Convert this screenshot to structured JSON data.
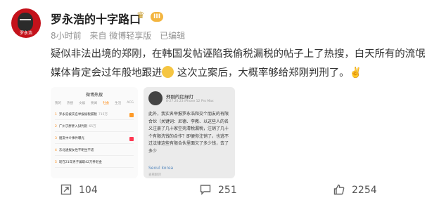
{
  "author": {
    "name": "罗永浩的十字路口",
    "badge_icon": "crown-icon",
    "level": "III",
    "avatar_caption": "罗永浩"
  },
  "meta": {
    "time": "8小时前",
    "source": "来自 微博轻享版",
    "edited": "已编辑"
  },
  "post": {
    "text_before_emoji": "疑似非法出境的郑刚，在韩国发帖诬陷我偷税漏税的帖子上了热搜，白天所有的流氓媒体肯定会过年般地跟进",
    "text_after_emoji": " 这次立案后，大概率够给郑刚判刑了。✌️"
  },
  "screenshot1": {
    "title": "微博热搜",
    "tabs": [
      "我的",
      "热搜",
      "文娱",
      "要闻",
      "社会",
      "生活",
      "ACG"
    ],
    "active_tab": 4,
    "rows": [
      {
        "num": "1",
        "text": "罗永浩被实名举报偷税漏税",
        "hot": "715万",
        "tag": "hot"
      },
      {
        "num": "2",
        "text": "广州于胖胖入狱判刑",
        "hot": "65万",
        "tag": ""
      },
      {
        "num": "3",
        "text": "朋友中介事件曝光",
        "hot": "",
        "tag": "new"
      },
      {
        "num": "4",
        "text": "东北通报女性不明生不适",
        "hot": "",
        "tag": ""
      },
      {
        "num": "5",
        "text": "现在21年男子骗取42万养老金",
        "hot": "",
        "tag": ""
      }
    ]
  },
  "screenshot2": {
    "name": "郑刚的红绿灯",
    "sub": "8-27 20:23 iPhone 12 Pro Max",
    "body": "此外，我实名举报罗永浩和交个朋友的有限合伙（关键词：尼德、李教、以这些人的名义注册了几十家空壳清税漏税，注销了几十个有限洗钱的合作？即便你注销了，也逃不过法律这些有限合伙里面欠了多少钱，去了多少",
    "location": "Seoul korea",
    "translate": "查看翻译"
  },
  "actions": {
    "share": {
      "icon": "share-icon",
      "count": "104"
    },
    "comment": {
      "icon": "comment-icon",
      "count": "251"
    },
    "like": {
      "icon": "like-icon",
      "count": "2254"
    }
  }
}
